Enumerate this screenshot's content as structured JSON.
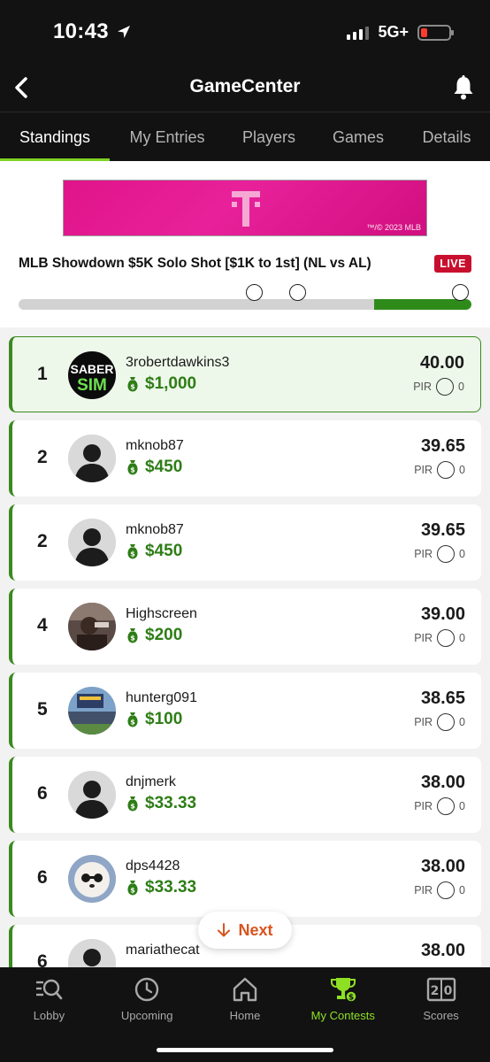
{
  "status": {
    "time": "10:43",
    "network": "5G+"
  },
  "nav": {
    "title": "GameCenter"
  },
  "tabs": [
    {
      "label": "Standings",
      "active": true
    },
    {
      "label": "My Entries"
    },
    {
      "label": "Players"
    },
    {
      "label": "Games"
    },
    {
      "label": "Details"
    }
  ],
  "banner": {
    "copyright": "™/© 2023 MLB"
  },
  "contest": {
    "title": "MLB Showdown $5K Solo Shot [$1K to 1st] (NL vs AL)",
    "live_label": "LIVE",
    "progress_fill": 0.215
  },
  "standings": [
    {
      "rank": "1",
      "username": "3robertdawkins3",
      "prize": "$1,000",
      "score": "40.00",
      "pir_label": "PIR",
      "pir": "0",
      "avatar": "sabersim-logo",
      "avatar_text": [
        "SABER",
        "SIM"
      ]
    },
    {
      "rank": "2",
      "username": "mknob87",
      "prize": "$450",
      "score": "39.65",
      "pir_label": "PIR",
      "pir": "0",
      "avatar": "default-avatar"
    },
    {
      "rank": "2",
      "username": "mknob87",
      "prize": "$450",
      "score": "39.65",
      "pir_label": "PIR",
      "pir": "0",
      "avatar": "default-avatar"
    },
    {
      "rank": "4",
      "username": "Highscreen",
      "prize": "$200",
      "score": "39.00",
      "pir_label": "PIR",
      "pir": "0",
      "avatar": "photo-avatar"
    },
    {
      "rank": "5",
      "username": "hunterg091",
      "prize": "$100",
      "score": "38.65",
      "pir_label": "PIR",
      "pir": "0",
      "avatar": "stadium-avatar"
    },
    {
      "rank": "6",
      "username": "dnjmerk",
      "prize": "$33.33",
      "score": "38.00",
      "pir_label": "PIR",
      "pir": "0",
      "avatar": "default-avatar"
    },
    {
      "rank": "6",
      "username": "dps4428",
      "prize": "$33.33",
      "score": "38.00",
      "pir_label": "PIR",
      "pir": "0",
      "avatar": "dog-avatar"
    },
    {
      "rank": "6",
      "username": "mariathecat",
      "prize": "",
      "score": "38.00",
      "pir_label": "",
      "pir": "",
      "avatar": "default-avatar"
    }
  ],
  "next_button": {
    "label": "Next"
  },
  "bottom_nav": [
    {
      "label": "Lobby",
      "icon": "lobby-search-icon"
    },
    {
      "label": "Upcoming",
      "icon": "clock-icon"
    },
    {
      "label": "Home",
      "icon": "home-icon"
    },
    {
      "label": "My Contests",
      "icon": "trophy-icon",
      "active": true
    },
    {
      "label": "Scores",
      "icon": "scoreboard-icon"
    }
  ],
  "colors": {
    "accent_green": "#7ed321",
    "money_green": "#2e7d16",
    "live_red": "#c8102e",
    "next_orange": "#d9541f",
    "banner_magenta": "#e0148a"
  }
}
